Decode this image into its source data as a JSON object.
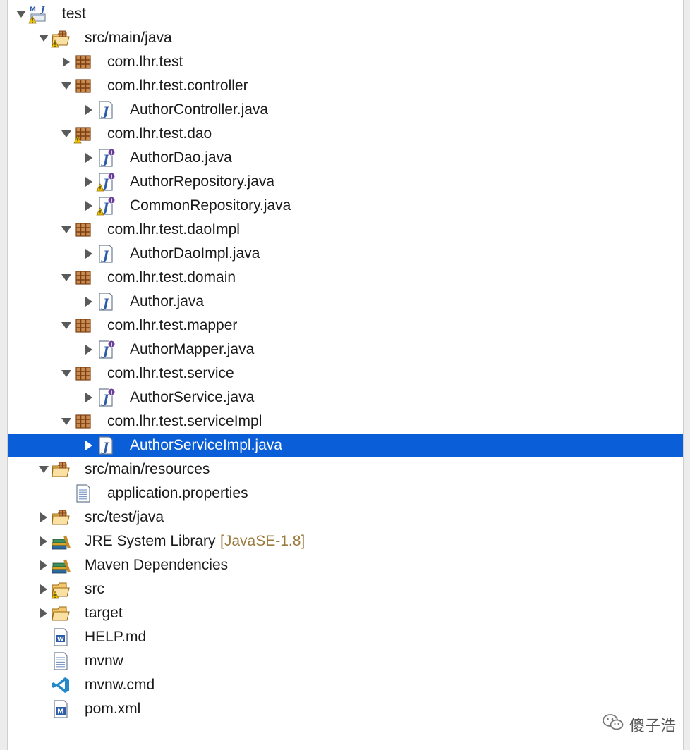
{
  "colors": {
    "selection": "#0a5fd8",
    "package_brown": "#8b4a1c",
    "warning_yellow": "#f2c200",
    "java_blue": "#2d5ca8",
    "decoration": "#9a7a3c"
  },
  "tree": [
    {
      "label": "test",
      "depth": 0,
      "twisty": "expanded",
      "icon": "maven-project-warning-icon"
    },
    {
      "label": "src/main/java",
      "depth": 1,
      "twisty": "expanded",
      "icon": "source-folder-warning-icon"
    },
    {
      "label": "com.lhr.test",
      "depth": 2,
      "twisty": "collapsed",
      "icon": "package-icon"
    },
    {
      "label": "com.lhr.test.controller",
      "depth": 2,
      "twisty": "expanded",
      "icon": "package-icon"
    },
    {
      "label": "AuthorController.java",
      "depth": 3,
      "twisty": "collapsed",
      "icon": "java-class-icon"
    },
    {
      "label": "com.lhr.test.dao",
      "depth": 2,
      "twisty": "expanded",
      "icon": "package-warning-icon"
    },
    {
      "label": "AuthorDao.java",
      "depth": 3,
      "twisty": "collapsed",
      "icon": "java-interface-icon"
    },
    {
      "label": "AuthorRepository.java",
      "depth": 3,
      "twisty": "collapsed",
      "icon": "java-interface-warning-icon"
    },
    {
      "label": "CommonRepository.java",
      "depth": 3,
      "twisty": "collapsed",
      "icon": "java-interface-warning-icon"
    },
    {
      "label": "com.lhr.test.daoImpl",
      "depth": 2,
      "twisty": "expanded",
      "icon": "package-icon"
    },
    {
      "label": "AuthorDaoImpl.java",
      "depth": 3,
      "twisty": "collapsed",
      "icon": "java-class-icon"
    },
    {
      "label": "com.lhr.test.domain",
      "depth": 2,
      "twisty": "expanded",
      "icon": "package-icon"
    },
    {
      "label": "Author.java",
      "depth": 3,
      "twisty": "collapsed",
      "icon": "java-class-icon"
    },
    {
      "label": "com.lhr.test.mapper",
      "depth": 2,
      "twisty": "expanded",
      "icon": "package-icon"
    },
    {
      "label": "AuthorMapper.java",
      "depth": 3,
      "twisty": "collapsed",
      "icon": "java-interface-icon"
    },
    {
      "label": "com.lhr.test.service",
      "depth": 2,
      "twisty": "expanded",
      "icon": "package-icon"
    },
    {
      "label": "AuthorService.java",
      "depth": 3,
      "twisty": "collapsed",
      "icon": "java-interface-icon"
    },
    {
      "label": "com.lhr.test.serviceImpl",
      "depth": 2,
      "twisty": "expanded",
      "icon": "package-icon"
    },
    {
      "label": "AuthorServiceImpl.java",
      "depth": 3,
      "twisty": "collapsed",
      "icon": "java-class-icon",
      "selected": true
    },
    {
      "label": "src/main/resources",
      "depth": 1,
      "twisty": "expanded",
      "icon": "source-folder-icon"
    },
    {
      "label": "application.properties",
      "depth": 2,
      "twisty": "none",
      "icon": "text-file-icon"
    },
    {
      "label": "src/test/java",
      "depth": 1,
      "twisty": "collapsed",
      "icon": "source-folder-icon"
    },
    {
      "label": "JRE System Library",
      "decoration": "[JavaSE-1.8]",
      "depth": 1,
      "twisty": "collapsed",
      "icon": "library-icon"
    },
    {
      "label": "Maven Dependencies",
      "depth": 1,
      "twisty": "collapsed",
      "icon": "library-icon"
    },
    {
      "label": "src",
      "depth": 1,
      "twisty": "collapsed",
      "icon": "folder-warning-icon"
    },
    {
      "label": "target",
      "depth": 1,
      "twisty": "collapsed",
      "icon": "folder-icon"
    },
    {
      "label": "HELP.md",
      "depth": 1,
      "twisty": "none",
      "icon": "markdown-file-icon"
    },
    {
      "label": "mvnw",
      "depth": 1,
      "twisty": "none",
      "icon": "text-file-icon"
    },
    {
      "label": "mvnw.cmd",
      "depth": 1,
      "twisty": "none",
      "icon": "vscode-file-icon"
    },
    {
      "label": "pom.xml",
      "depth": 1,
      "twisty": "none",
      "icon": "maven-pom-icon"
    }
  ],
  "watermark": {
    "text": "傻子浩",
    "icon": "wechat-icon"
  }
}
